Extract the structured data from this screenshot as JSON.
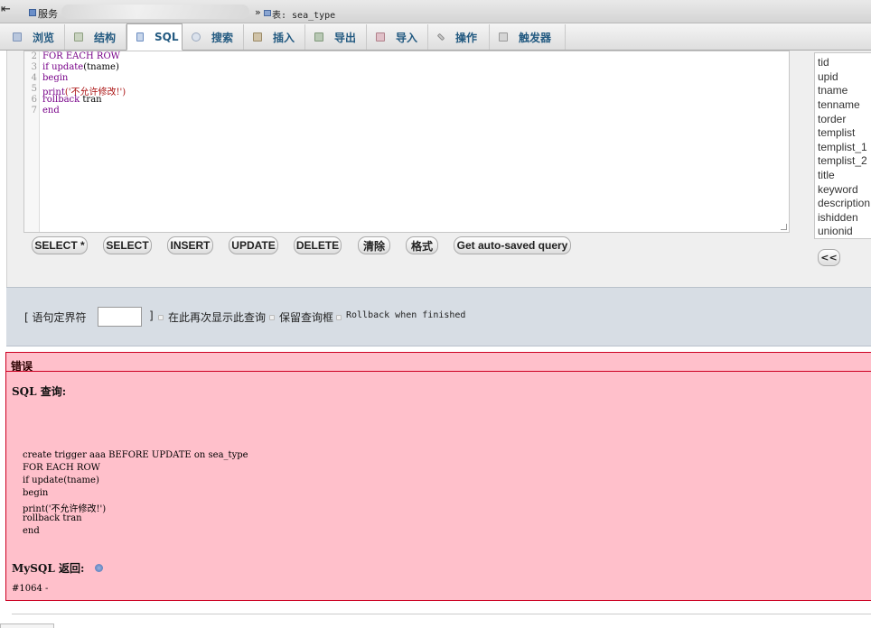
{
  "breadcrumb": {
    "server_label": "服务",
    "separator": "»",
    "table_label": "表: sea_type"
  },
  "tabs": [
    {
      "label": "浏览",
      "icon": "browse-icon"
    },
    {
      "label": "结构",
      "icon": "structure-icon"
    },
    {
      "label": "SQL",
      "icon": "sql-icon",
      "active": true
    },
    {
      "label": "搜索",
      "icon": "search-icon"
    },
    {
      "label": "插入",
      "icon": "insert-icon"
    },
    {
      "label": "导出",
      "icon": "export-icon"
    },
    {
      "label": "导入",
      "icon": "import-icon"
    },
    {
      "label": "操作",
      "icon": "wrench-icon"
    },
    {
      "label": "触发器",
      "icon": "trigger-icon"
    }
  ],
  "editor": {
    "line_numbers": [
      "2",
      "3",
      "4",
      "5",
      "6",
      "7"
    ],
    "lines": [
      [
        {
          "t": "FOR EACH ROW",
          "c": "kw"
        }
      ],
      [
        {
          "t": "if ",
          "c": "kw"
        },
        {
          "t": "update",
          "c": "fn"
        },
        {
          "t": "(tname)",
          "c": "plain"
        }
      ],
      [
        {
          "t": "begin",
          "c": "kw"
        }
      ],
      [
        {
          "t": "print",
          "c": "fn"
        },
        {
          "t": "('不允许修改!')",
          "c": "str"
        }
      ],
      [
        {
          "t": "rollback",
          "c": "kw"
        },
        {
          "t": " tran",
          "c": "plain"
        }
      ],
      [
        {
          "t": "end",
          "c": "kw"
        }
      ]
    ]
  },
  "buttons": {
    "select_star": "SELECT *",
    "select": "SELECT",
    "insert": "INSERT",
    "update": "UPDATE",
    "delete": "DELETE",
    "clear": "清除",
    "format": "格式",
    "auto_saved": "Get auto-saved query"
  },
  "fields": [
    "tid",
    "upid",
    "tname",
    "tenname",
    "torder",
    "templist",
    "templist_1",
    "templist_2",
    "title",
    "keyword",
    "description",
    "ishidden",
    "unionid"
  ],
  "insert_field_button": "<<",
  "options": {
    "delimiter_open": "[ 语句定界符",
    "delimiter_value": "",
    "delimiter_close": "]",
    "show_query_again": "在此再次显示此查询",
    "retain_query_box": "保留查询框",
    "rollback_when_finished": "Rollback when finished"
  },
  "error": {
    "title": "错误",
    "sql_query_label": "SQL 查询:",
    "query_lines": [
      "create trigger aaa BEFORE UPDATE on sea_type",
      "FOR EACH ROW",
      "if update(tname)",
      "begin",
      "print('不允许修改!')",
      "rollback tran",
      "end"
    ],
    "mysql_said_label": "MySQL 返回:",
    "doc_icon": "documentation-icon",
    "error_code": "#1064 -"
  },
  "colors": {
    "error_bg": "#ffc0cb",
    "error_border": "#cc0022",
    "options_bg": "#d7dde4",
    "tab_text": "#235a81"
  }
}
